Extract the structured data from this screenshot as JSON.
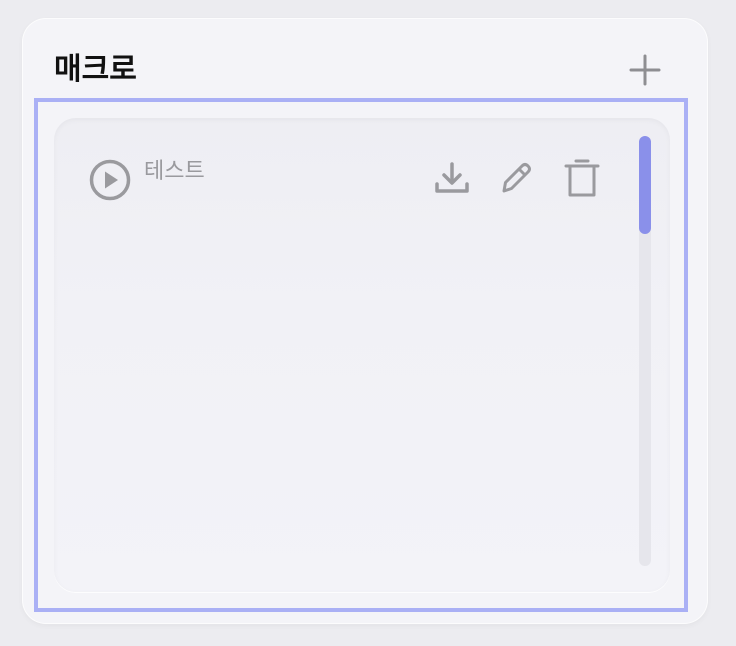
{
  "header": {
    "title": "매크로"
  },
  "macros": [
    {
      "name": "테스트"
    }
  ],
  "colors": {
    "accent": "#8a90ea",
    "focus_border": "#aab0f5",
    "icon_gray": "#9a9a9e"
  },
  "icons": {
    "add": "plus-icon",
    "play": "play-circle-icon",
    "download": "download-icon",
    "edit": "pencil-icon",
    "delete": "trash-icon"
  }
}
